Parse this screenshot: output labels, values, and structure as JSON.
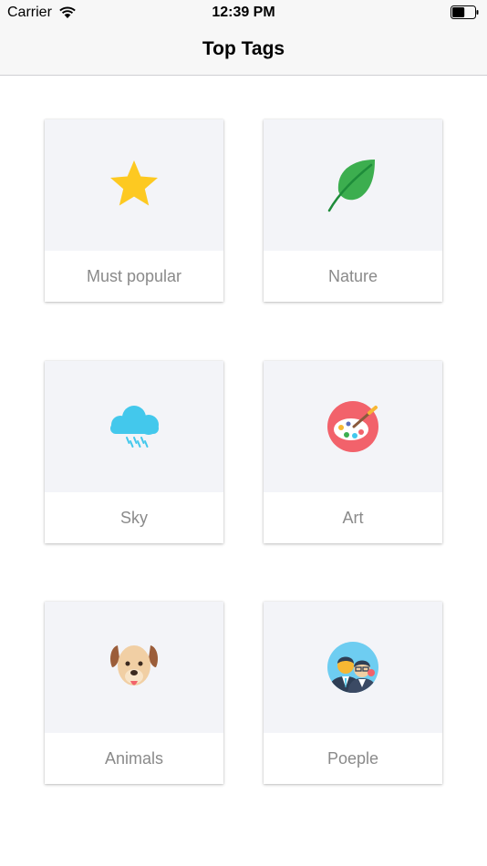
{
  "status_bar": {
    "carrier": "Carrier",
    "time": "12:39 PM",
    "battery_level": 0.55
  },
  "nav": {
    "title": "Top Tags"
  },
  "tags": [
    {
      "label": "Must popular",
      "icon": "star-icon"
    },
    {
      "label": "Nature",
      "icon": "leaf-icon"
    },
    {
      "label": "Sky",
      "icon": "rain-cloud-icon"
    },
    {
      "label": "Art",
      "icon": "paint-palette-icon"
    },
    {
      "label": "Animals",
      "icon": "dog-face-icon"
    },
    {
      "label": "Poeple",
      "icon": "people-icon"
    }
  ],
  "colors": {
    "tile_top": "#f3f4f8",
    "label": "#8a8a8a",
    "star": "#fdc921",
    "leaf": "#3cae4f",
    "cloud": "#43c8ec",
    "palette": "#f2626b",
    "dog": "#f1cfa4",
    "people_bg": "#6ecdf1"
  }
}
